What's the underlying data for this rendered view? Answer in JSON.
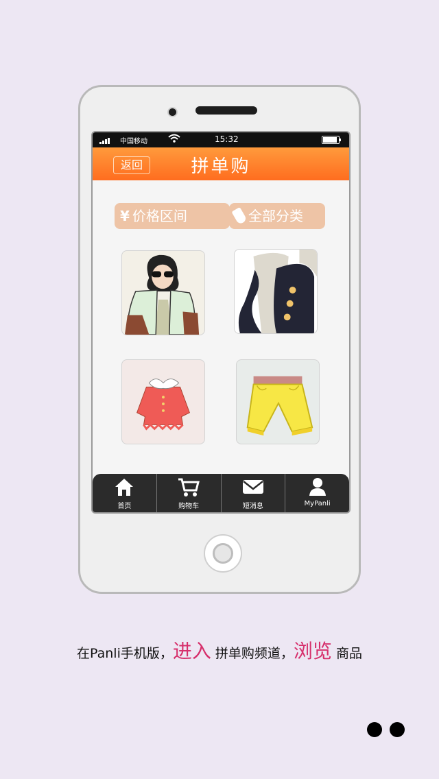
{
  "status_bar": {
    "carrier": "中国移动",
    "time": "15:32"
  },
  "header": {
    "back_label": "返回",
    "title": "拼单购"
  },
  "filters": {
    "price_label": "价格区间",
    "category_label": "全部分类"
  },
  "products": [
    {
      "icon": "jacket-woman-image"
    },
    {
      "icon": "coat-image"
    },
    {
      "icon": "red-blouse-image"
    },
    {
      "icon": "yellow-shorts-image"
    }
  ],
  "tabs": [
    {
      "label": "首页",
      "icon": "home-icon"
    },
    {
      "label": "购物车",
      "icon": "cart-icon"
    },
    {
      "label": "短消息",
      "icon": "mail-icon"
    },
    {
      "label": "MyPanli",
      "icon": "user-icon"
    }
  ],
  "caption": {
    "part1": "在Panli手机版，",
    "highlight1": "进入",
    "part2": " 拼单购频道，",
    "highlight2": "浏览",
    "part3": " 商品"
  },
  "colors": {
    "accent": "#ff7a26",
    "highlight": "#d62f6b",
    "filter_bg": "#eec4a6"
  }
}
